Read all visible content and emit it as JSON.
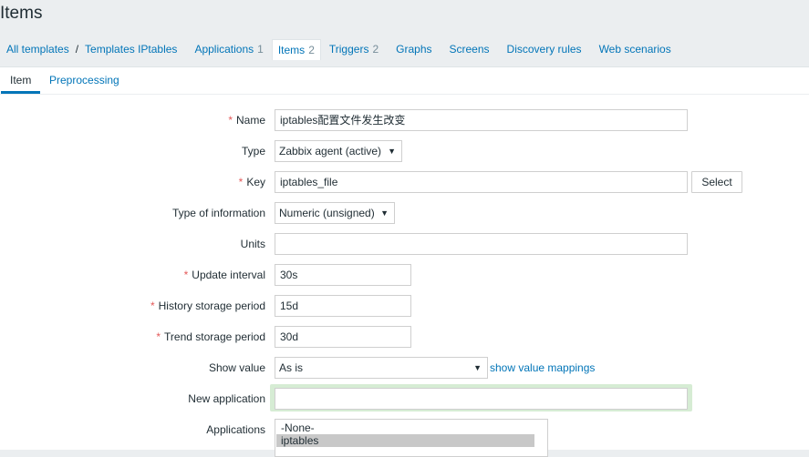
{
  "page": {
    "title": "Items"
  },
  "breadcrumbs": [
    {
      "label": "All templates"
    },
    {
      "label": "Templates IPtables"
    }
  ],
  "nav": {
    "applications": {
      "label": "Applications",
      "count": "1"
    },
    "items": {
      "label": "Items",
      "count": "2"
    },
    "triggers": {
      "label": "Triggers",
      "count": "2"
    },
    "graphs": {
      "label": "Graphs"
    },
    "screens": {
      "label": "Screens"
    },
    "discovery": {
      "label": "Discovery rules"
    },
    "web": {
      "label": "Web scenarios"
    }
  },
  "tabs": {
    "item": "Item",
    "preprocessing": "Preprocessing"
  },
  "form": {
    "name": {
      "label": "Name",
      "value": "iptables配置文件发生改变",
      "required": true
    },
    "type": {
      "label": "Type",
      "value": "Zabbix agent (active)"
    },
    "key": {
      "label": "Key",
      "value": "iptables_file",
      "required": true,
      "button": "Select"
    },
    "type_of_information": {
      "label": "Type of information",
      "value": "Numeric (unsigned)"
    },
    "units": {
      "label": "Units",
      "value": ""
    },
    "update_interval": {
      "label": "Update interval",
      "value": "30s",
      "required": true
    },
    "history": {
      "label": "History storage period",
      "value": "15d",
      "required": true
    },
    "trend": {
      "label": "Trend storage period",
      "value": "30d",
      "required": true
    },
    "show_value": {
      "label": "Show value",
      "value": "As is",
      "link": "show value mappings"
    },
    "new_application": {
      "label": "New application",
      "value": ""
    },
    "applications": {
      "label": "Applications",
      "options": [
        "-None-",
        "iptables"
      ],
      "selected": "iptables"
    }
  },
  "required_marker": "*",
  "colors": {
    "link": "#0275b8",
    "required": "#e45959",
    "focus_glow": "#d6ecd4",
    "background": "#ebeef0"
  }
}
